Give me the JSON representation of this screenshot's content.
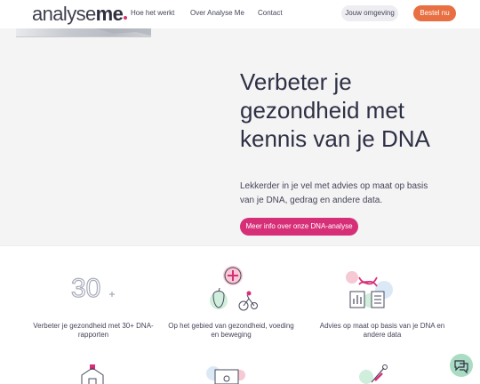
{
  "header": {
    "logo_text": "analyse",
    "logo_bold": "me",
    "nav": [
      "Hoe het werkt",
      "Over Analyse Me",
      "Contact"
    ],
    "env_button": "Jouw omgeving",
    "order_button": "Bestel nu"
  },
  "hero": {
    "title": "Verbeter je gezondheid met kennis van je DNA",
    "text": "Lekkerder in je vel met advies op maat op basis van je DNA, gedrag en andere data.",
    "cta": "Meer info over onze DNA-analyse"
  },
  "features": [
    {
      "icon": "thirty-plus-icon",
      "number": "30",
      "label": "Verbeter je gezondheid met 30+ DNA-rapporten"
    },
    {
      "icon": "health-nutrition-exercise-icon",
      "label": "Op het gebied van gezondheid, voeding en beweging"
    },
    {
      "icon": "dna-report-icon",
      "label": "Advies op maat op basis van je DNA en andere data"
    }
  ],
  "colors": {
    "accent_pink": "#d62f78",
    "accent_orange": "#e86f42",
    "chat_green": "#a9dcc3"
  }
}
